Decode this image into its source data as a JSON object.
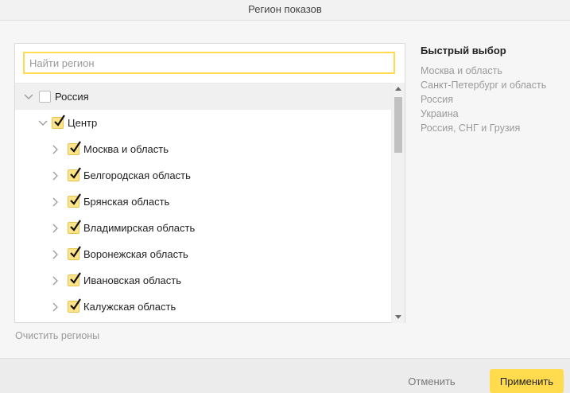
{
  "dialog": {
    "title": "Регион показов"
  },
  "search": {
    "placeholder": "Найти регион",
    "value": ""
  },
  "tree": {
    "root": {
      "label": "Россия",
      "checked": false,
      "expanded": true
    },
    "group": {
      "label": "Центр",
      "checked": true,
      "expanded": true
    },
    "items": [
      {
        "label": "Москва и область",
        "checked": true
      },
      {
        "label": "Белгородская область",
        "checked": true
      },
      {
        "label": "Брянская область",
        "checked": true
      },
      {
        "label": "Владимирская область",
        "checked": true
      },
      {
        "label": "Воронежская область",
        "checked": true
      },
      {
        "label": "Ивановская область",
        "checked": true
      },
      {
        "label": "Калужская область",
        "checked": true
      }
    ]
  },
  "quick_select": {
    "title": "Быстрый выбор",
    "items": [
      "Москва и область",
      "Санкт-Петербург и область",
      "Россия",
      "Украина",
      "Россия, СНГ и Грузия"
    ]
  },
  "clear_label": "Очистить регионы",
  "footer": {
    "cancel_label": "Отменить",
    "apply_label": "Применить"
  },
  "colors": {
    "accent": "#ffdb4d",
    "checkbox_checked": "#fde38a"
  }
}
